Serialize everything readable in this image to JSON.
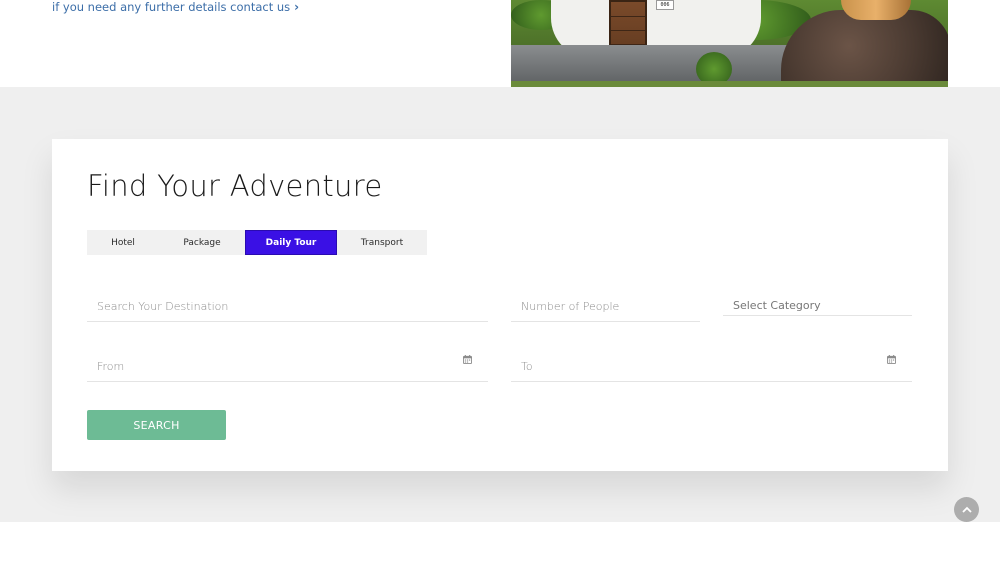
{
  "contact": {
    "text": "if you need any further details contact us",
    "chevron": "›"
  },
  "hero": {
    "house_number": "006"
  },
  "search_card": {
    "title": "Find Your Adventure",
    "tabs": [
      {
        "label": "Hotel",
        "active": false
      },
      {
        "label": "Package",
        "active": false
      },
      {
        "label": "Daily Tour",
        "active": true
      },
      {
        "label": "Transport",
        "active": false
      }
    ],
    "fields": {
      "destination": {
        "placeholder": "Search Your Destination",
        "value": ""
      },
      "people": {
        "placeholder": "Number of People",
        "value": ""
      },
      "category": {
        "selected": "Select Category"
      },
      "from": {
        "placeholder": "From",
        "value": ""
      },
      "to": {
        "placeholder": "To",
        "value": ""
      }
    },
    "search_label": "SEARCH"
  },
  "icons": {
    "calendar": "calendar-icon",
    "arrow_up": "arrow-up-icon",
    "chevron": "chevron-right-icon"
  },
  "colors": {
    "active_tab": "#3a10e5",
    "search_button": "#6dbb95",
    "link": "#3c6ea8",
    "section_bg": "#efefef"
  }
}
